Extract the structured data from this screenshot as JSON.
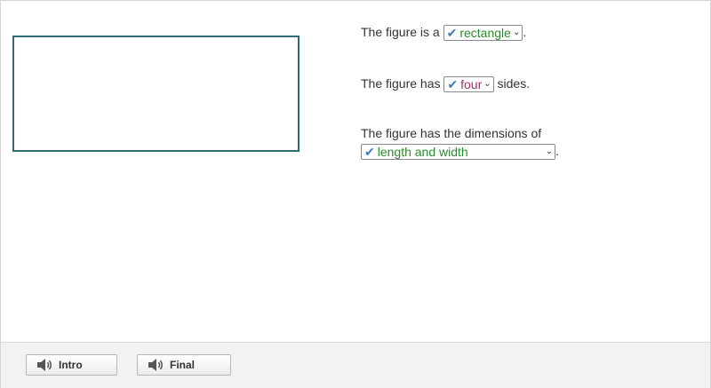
{
  "questions": [
    {
      "prefix": "The figure is a",
      "answer": "rectangle",
      "suffix": "."
    },
    {
      "prefix": "The figure has",
      "answer": "four",
      "suffix": "sides."
    },
    {
      "prefix": "The figure has the dimensions of",
      "answer": "length and width",
      "suffix": "."
    }
  ],
  "footer": {
    "intro_label": "Intro",
    "final_label": "Final"
  },
  "icons": {
    "answer_mark": "✔",
    "dropdown": "chevron-down-icon",
    "audio": "speaker-icon"
  },
  "colors": {
    "figure_border": "#2e6b73",
    "correct_text": "#2b8a2b",
    "pink_text": "#a3306a"
  }
}
